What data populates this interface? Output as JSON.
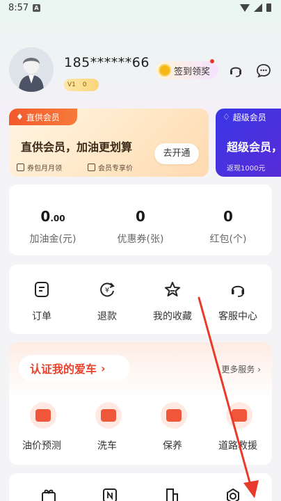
{
  "status_bar": {
    "time": "8:57",
    "notif": "A"
  },
  "profile": {
    "phone": "185******66",
    "vip_level": "V1",
    "vip_points": "0",
    "sign_label": "签到领奖"
  },
  "member_card": {
    "tag": "直供会员",
    "title": "直供会员，加油更划算",
    "perk1": "券包月月领",
    "perk2": "会员专享价",
    "open_button": "去开通"
  },
  "super_card": {
    "tag": "超级会员",
    "title": "超级会员，",
    "perk": "返现1000元"
  },
  "stats": [
    {
      "value_int": "0",
      "value_dec": ".00",
      "label": "加油金(元)"
    },
    {
      "value_int": "0",
      "value_dec": "",
      "label": "优惠券(张)"
    },
    {
      "value_int": "0",
      "value_dec": "",
      "label": "红包(个)"
    }
  ],
  "menu": [
    {
      "label": "订单",
      "icon": "order-icon"
    },
    {
      "label": "退款",
      "icon": "refund-icon"
    },
    {
      "label": "我的收藏",
      "icon": "star-icon"
    },
    {
      "label": "客服中心",
      "icon": "customer-service-icon"
    }
  ],
  "car_section": {
    "verify_label": "认证我的爱车",
    "more_label": "更多服务",
    "services": [
      {
        "label": "油价预测",
        "icon": "oil-price-icon"
      },
      {
        "label": "洗车",
        "icon": "car-wash-icon"
      },
      {
        "label": "保养",
        "icon": "maintenance-icon"
      },
      {
        "label": "道路救援",
        "icon": "road-rescue-icon"
      }
    ]
  },
  "colors": {
    "accent": "#e8432c",
    "member_orange": "#f4592c",
    "super_blue": "#3a36e6",
    "annotation_red": "#e83a2a"
  }
}
